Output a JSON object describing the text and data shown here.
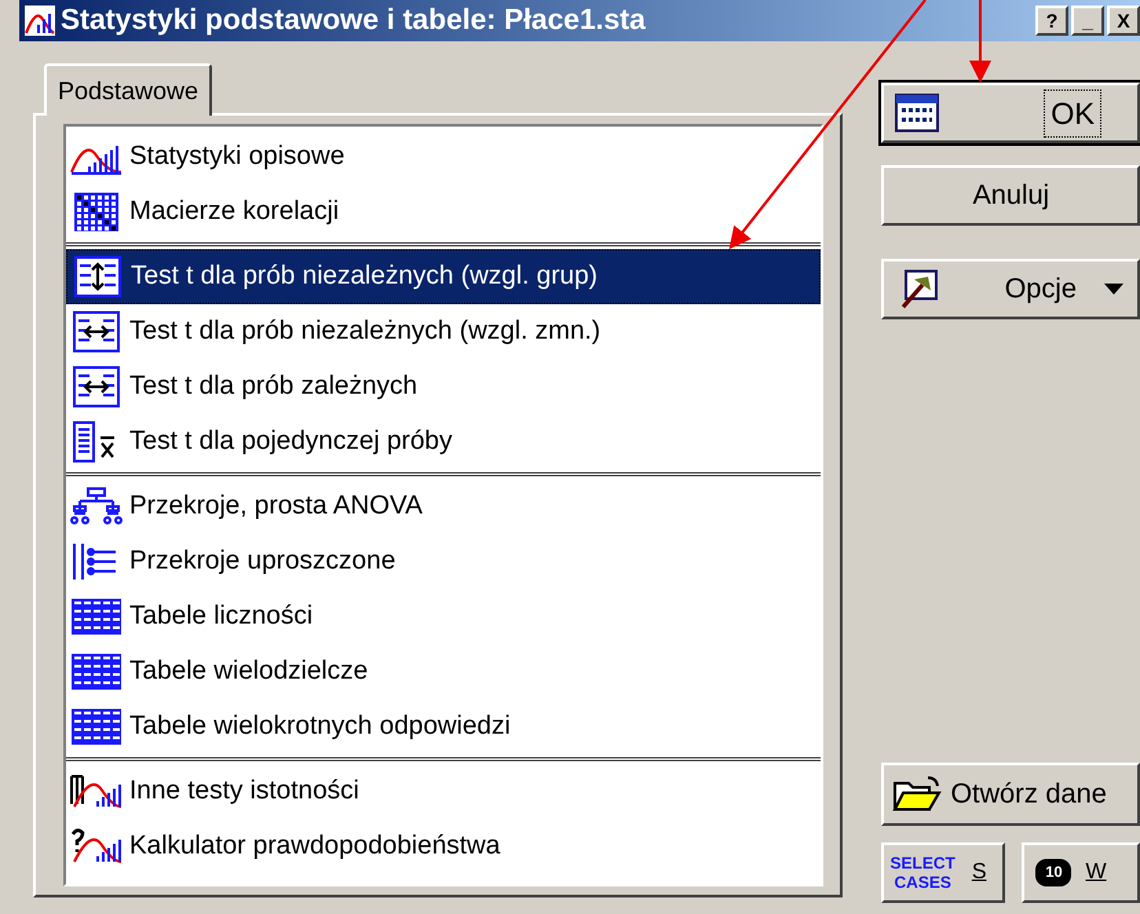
{
  "window": {
    "title": "Statystyki podstawowe i tabele: Płace1.sta",
    "controls": [
      "?",
      "_",
      "X"
    ]
  },
  "tabs": [
    {
      "label": "Podstawowe",
      "selected": true
    }
  ],
  "list_groups": [
    {
      "items": [
        {
          "label": "Statystyki opisowe",
          "kind": "distribution",
          "selected": false
        },
        {
          "label": "Macierze korelacji",
          "kind": "matrix",
          "selected": false
        }
      ]
    },
    {
      "items": [
        {
          "label": "Test t dla prób niezależnych (wzgl. grup)",
          "kind": "groups",
          "selected": true
        },
        {
          "label": "Test t dla prób niezależnych (wzgl. zmn.)",
          "kind": "compare",
          "selected": false
        },
        {
          "label": "Test t dla prób zależnych",
          "kind": "compare",
          "selected": false
        },
        {
          "label": "Test t dla pojedynczej próby",
          "kind": "single",
          "selected": false
        }
      ]
    },
    {
      "items": [
        {
          "label": "Przekroje, prosta ANOVA",
          "kind": "tree",
          "selected": false
        },
        {
          "label": "Przekroje uproszczone",
          "kind": "branch",
          "selected": false
        },
        {
          "label": "Tabele liczności",
          "kind": "table",
          "selected": false
        },
        {
          "label": "Tabele wielodzielcze",
          "kind": "table",
          "selected": false
        },
        {
          "label": "Tabele wielokrotnych odpowiedzi",
          "kind": "table",
          "selected": false
        }
      ]
    },
    {
      "items": [
        {
          "label": "Inne testy istotności",
          "kind": "tests",
          "selected": false
        },
        {
          "label": "Kalkulator prawdopodobieństwa",
          "kind": "calculator",
          "selected": false
        }
      ]
    }
  ],
  "buttons": {
    "ok": {
      "label": "OK",
      "focused": true
    },
    "cancel": {
      "label": "Anuluj"
    },
    "options": {
      "label": "Opcje"
    },
    "open_data": {
      "label": "Otwórz dane"
    },
    "select_cases": {
      "icon_text": [
        "SELECT",
        "CASES"
      ],
      "label": "S"
    },
    "weight": {
      "icon_text": "10",
      "label": "W"
    }
  }
}
